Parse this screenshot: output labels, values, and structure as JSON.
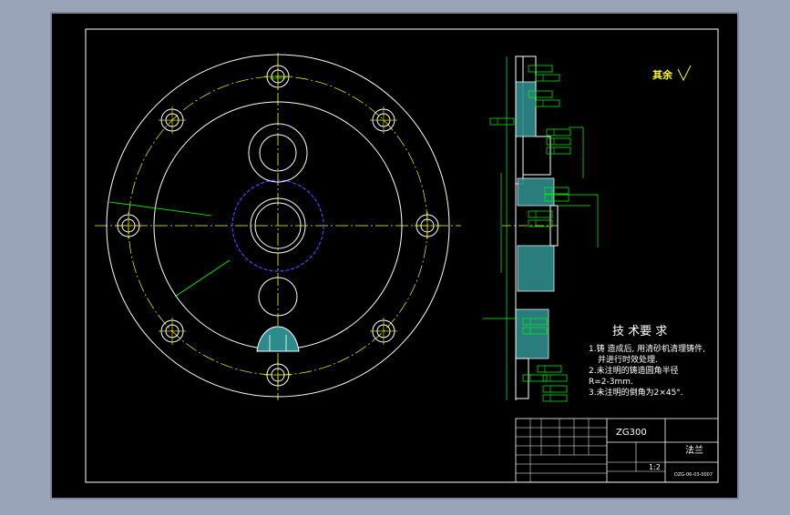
{
  "drawing": {
    "roughness_note": "其余",
    "tech_req": {
      "title": "技 术要 求",
      "lines": [
        "1.铸 造成后, 用清砂机清理铸件,",
        "并进行时效处理.",
        "2.未注明的铸造圆角半径",
        "R=2-3mm.",
        "3.未注明的倒角为2×45°."
      ]
    },
    "title_block": {
      "material": "ZG300",
      "part_name": "法兰",
      "scale": "1:2",
      "drawing_no": "DZG-06-03-0007"
    }
  },
  "colors": {
    "background": "#000000",
    "frame": "#ffffff",
    "centerline": "#ffff00",
    "dimension": "#00ff00",
    "hidden_circle": "#0000ff",
    "hatch_fill": "#2e8b8b"
  }
}
